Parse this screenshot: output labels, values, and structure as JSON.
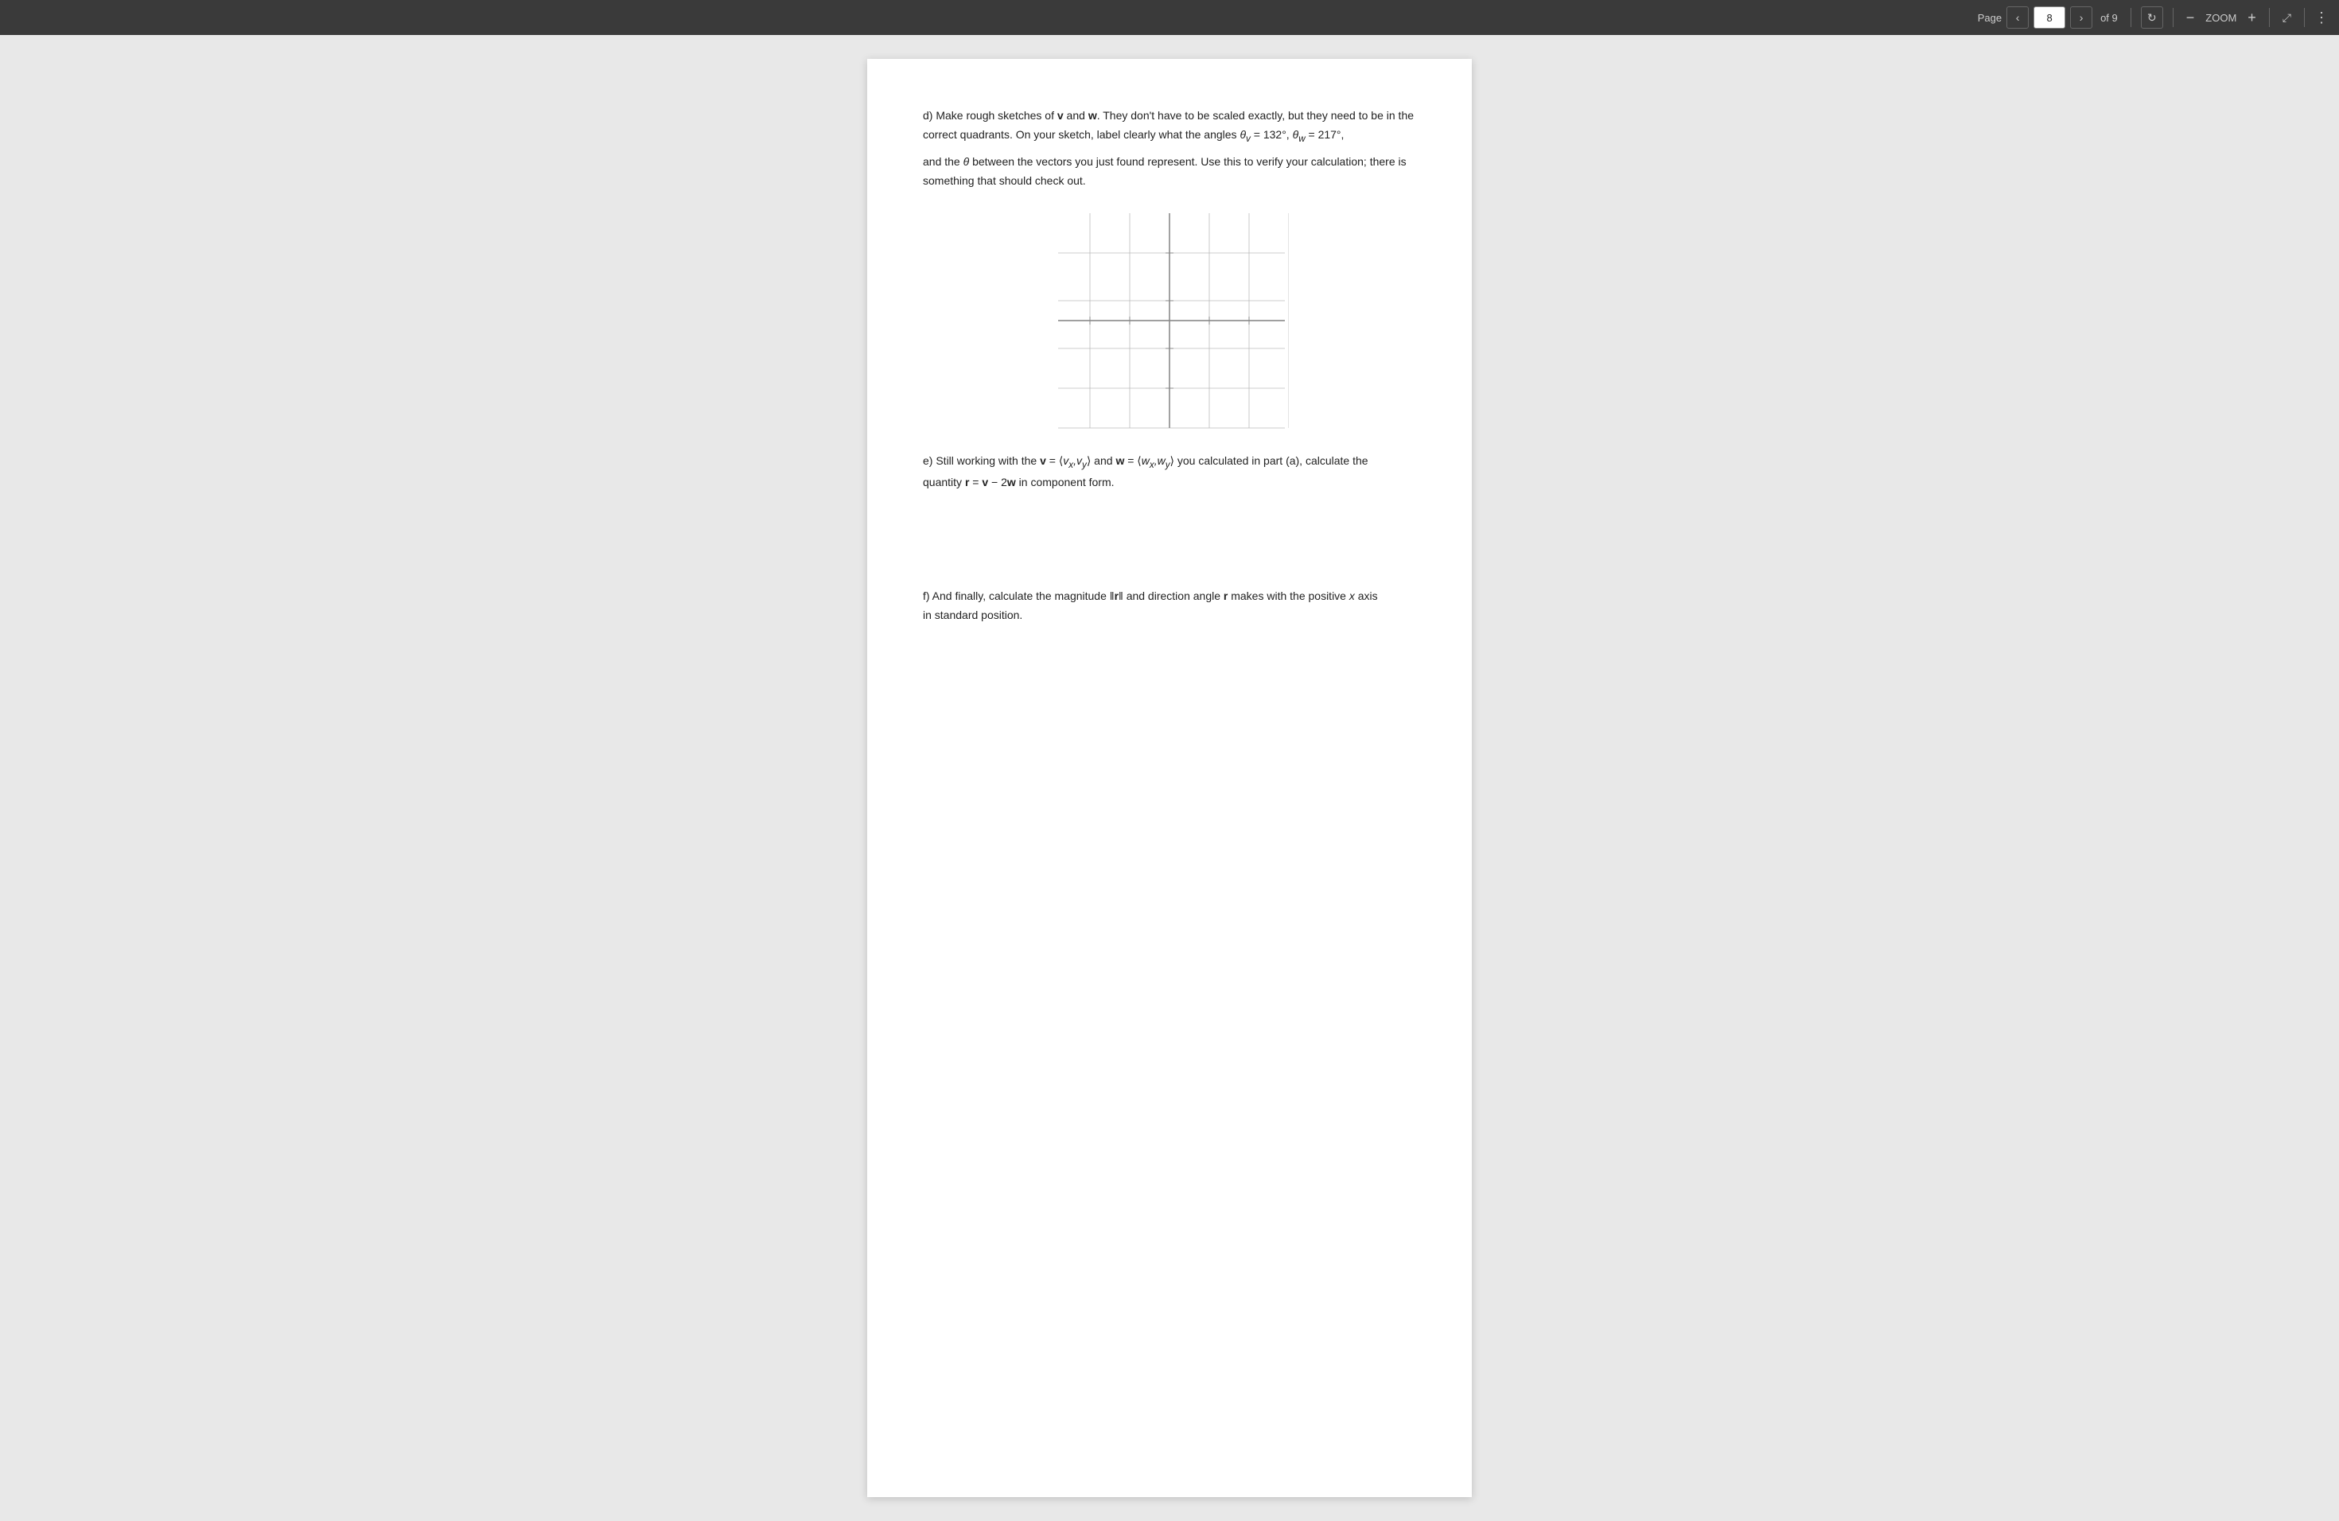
{
  "toolbar": {
    "page_label": "Page",
    "current_page": "8",
    "of_label": "of 9",
    "zoom_label": "ZOOM",
    "prev_icon": "‹",
    "next_icon": "›",
    "refresh_icon": "↻",
    "fullscreen_icon": "⤢",
    "dots_icon": "⋮"
  },
  "content": {
    "part_d": {
      "text1": "d) Make rough sketches of ",
      "v_bold": "v",
      "text2": " and ",
      "w_bold": "w",
      "text3": ". They don't have to be scaled exactly, but they need to be in the correct quadrants. On your sketch, label clearly what the angles ",
      "theta_v": "θ",
      "v_sub": "v",
      "eq1": " =132°, ",
      "theta_w": "θ",
      "w_sub": "w",
      "eq2": " = 217°,",
      "text4": "and the ",
      "theta": "θ",
      "text5": " between the vectors you just found represent. Use this to verify your calculation; there is something that should check out."
    },
    "part_e": {
      "intro": "e)  Still working with the ",
      "v_bold": "v",
      "text2": " = ",
      "angle_v": "⟨v",
      "vx_sub": "x",
      "comma": ",v",
      "vy_sub": "y",
      "angle_close": "⟩",
      "text3": "and ",
      "w_bold": "w",
      "text4": " = ",
      "angle_w": "⟨w",
      "wx_sub": "x",
      "comma2": ",w",
      "wy_sub": "y",
      "angle_close2": "⟩",
      "text5": " you calculated in part (a), calculate the",
      "quantity_line": "quantity ",
      "r_bold": "r",
      "eq": " = v − 2w",
      "text6": " in component form."
    },
    "part_f": {
      "intro": "f) And finally, calculate the magnitude ",
      "r_norm": "‖r‖",
      "text2": " and direction angle ",
      "r_bold": "r",
      "text3": " makes with the positive ",
      "x_italic": "x",
      "text4": " axis",
      "text5": "in standard position."
    }
  }
}
